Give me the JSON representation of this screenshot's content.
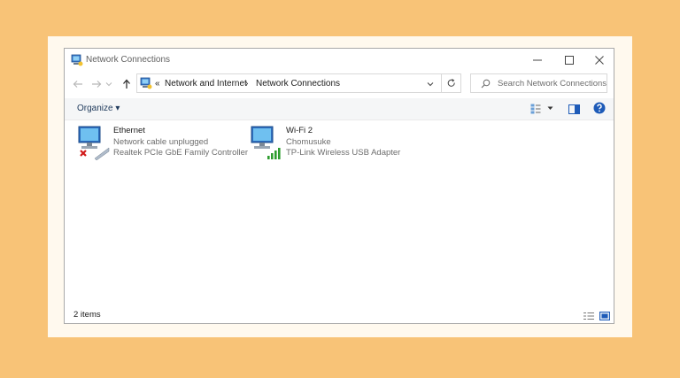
{
  "window": {
    "title": "Network Connections",
    "controls": [
      "minimize-icon",
      "maximize-icon",
      "close-icon"
    ]
  },
  "address": {
    "overflow": "«",
    "crumbs": [
      "Network and Internet",
      "Network Connections"
    ],
    "separator": "›"
  },
  "search": {
    "placeholder": "Search Network Connections"
  },
  "toolbar": {
    "organize_label": "Organize ▾"
  },
  "items": [
    {
      "name": "Ethernet",
      "status": "Network cable unplugged",
      "device": "Realtek PCIe GbE Family Controller",
      "icon": "ethernet-adapter-icon"
    },
    {
      "name": "Wi-Fi 2",
      "status": "Chomusuke",
      "device": "TP-Link Wireless USB Adapter",
      "icon": "wifi-adapter-icon"
    }
  ],
  "status": {
    "count_text": "2 items"
  },
  "colors": {
    "background": "#f8c377",
    "accent": "#1e5bb8",
    "error": "#d11a1a",
    "signal": "#2e9d2e"
  }
}
